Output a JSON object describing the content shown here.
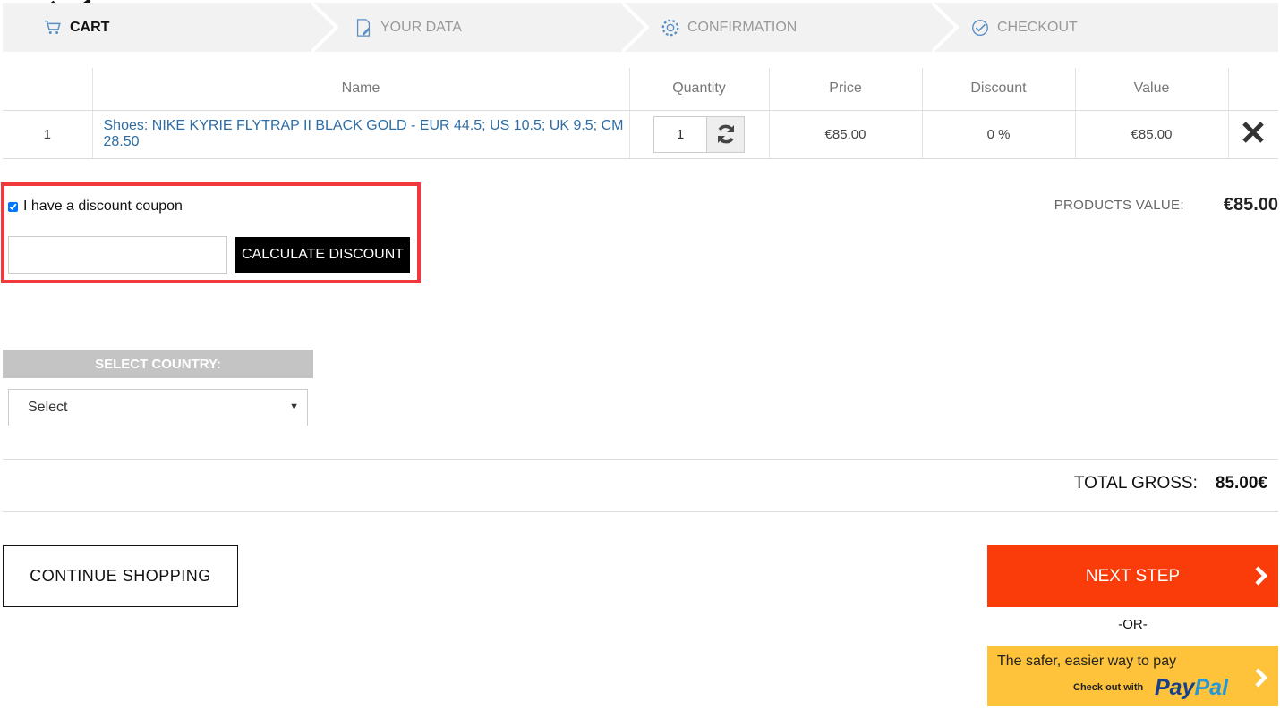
{
  "steps": [
    {
      "label": "CART",
      "icon": "cart-icon",
      "active": true
    },
    {
      "label": "YOUR DATA",
      "icon": "document-pen-icon",
      "active": false
    },
    {
      "label": "CONFIRMATION",
      "icon": "gear-icon",
      "active": false
    },
    {
      "label": "CHECKOUT",
      "icon": "check-badge-icon",
      "active": false
    }
  ],
  "table": {
    "headers": [
      "",
      "Name",
      "Quantity",
      "Price",
      "Discount",
      "Value",
      ""
    ],
    "rows": [
      {
        "index": "1",
        "name": "Shoes: NIKE KYRIE FLYTRAP II BLACK GOLD - EUR 44.5; US 10.5; UK 9.5; CM 28.50",
        "quantity": "1",
        "price": "€85.00",
        "discount": "0 %",
        "value": "€85.00"
      }
    ]
  },
  "coupon": {
    "checkbox_label": "I have a discount coupon",
    "checked": true,
    "input_value": "",
    "button_label": "CALCULATE DISCOUNT"
  },
  "products_value": {
    "label": "PRODUCTS VALUE:",
    "value": "€85.00"
  },
  "country": {
    "heading": "SELECT COUNTRY:",
    "selected": "Select"
  },
  "total": {
    "label": "TOTAL GROSS:",
    "value": "85.00€"
  },
  "actions": {
    "continue_label": "CONTINUE SHOPPING",
    "next_label": "NEXT STEP",
    "or_label": "-OR-",
    "paypal_line1": "The safer, easier way to pay",
    "paypal_line2": "Check out with",
    "paypal_logo_pay": "Pay",
    "paypal_logo_pal": "Pal"
  },
  "colors": {
    "highlight_border": "#f0393d",
    "next_button": "#f93c09",
    "paypal_button": "#fec33a",
    "link": "#2e6da4"
  }
}
